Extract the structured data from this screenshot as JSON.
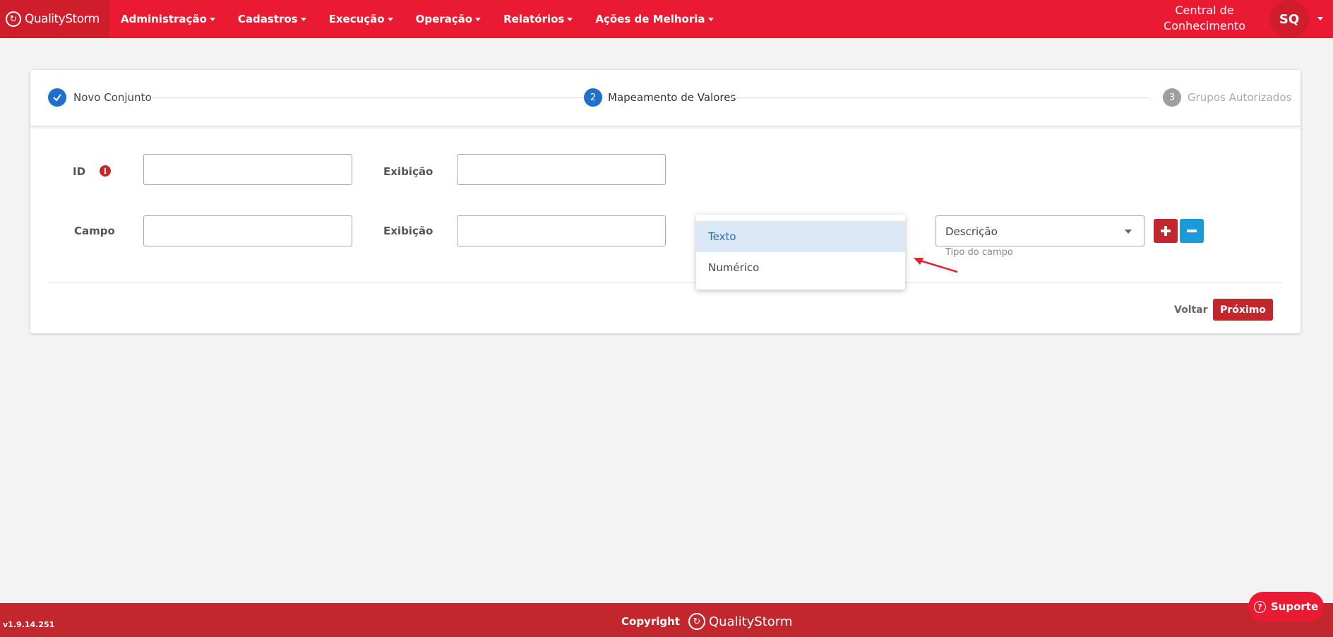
{
  "brand": {
    "name": "QualityStorm"
  },
  "nav": [
    {
      "label": "Administração"
    },
    {
      "label": "Cadastros"
    },
    {
      "label": "Execução"
    },
    {
      "label": "Operação"
    },
    {
      "label": "Relatórios"
    },
    {
      "label": "Ações de Melhoria"
    }
  ],
  "header": {
    "central_line1": "Central de",
    "central_line2": "Conhecimento",
    "avatar": "SQ"
  },
  "stepper": {
    "steps": [
      {
        "number": "",
        "label": "Novo Conjunto",
        "state": "done"
      },
      {
        "number": "2",
        "label": "Mapeamento de Valores",
        "state": "active"
      },
      {
        "number": "3",
        "label": "Grupos Autorizados",
        "state": "pending"
      }
    ]
  },
  "form": {
    "id_label": "ID",
    "exibicao_label_1": "Exibição",
    "campo_label": "Campo",
    "exibicao_label_2": "Exibição",
    "tipo_select": {
      "value": "Descrição",
      "hint": "Tipo do campo"
    },
    "dropdown": {
      "options": [
        "Texto",
        "Numérico"
      ],
      "selected": "Texto"
    }
  },
  "actions": {
    "back": "Voltar",
    "next": "Próximo"
  },
  "footer": {
    "version": "v1.9.14.251",
    "copyright": "Copyright",
    "brand": "QualityStorm"
  },
  "support": {
    "label": "Suporte"
  },
  "colors": {
    "primary": "#ea1a33",
    "dark_red": "#c1272d",
    "blue": "#1f6fcd",
    "cyan": "#1a9bd7"
  }
}
